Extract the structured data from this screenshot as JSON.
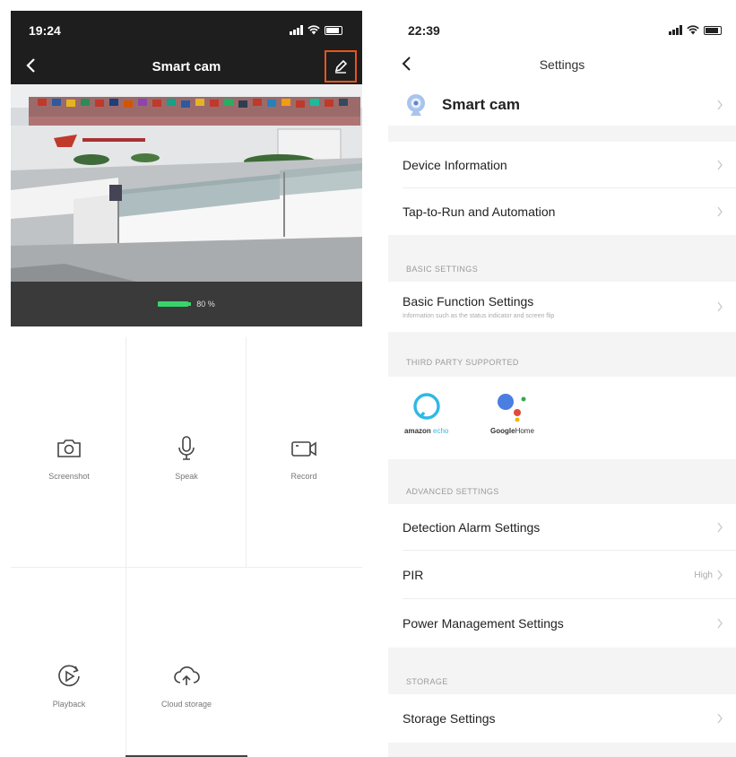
{
  "left_phone": {
    "status_time": "19:24",
    "nav_title": "Smart cam",
    "battery_text": "80 %",
    "battery_level": 0.8,
    "actions": [
      {
        "label": "Screenshot",
        "icon": "camera-icon"
      },
      {
        "label": "Speak",
        "icon": "microphone-icon"
      },
      {
        "label": "Record",
        "icon": "video-record-icon"
      },
      {
        "label": "Playback",
        "icon": "playback-icon"
      },
      {
        "label": "Cloud storage",
        "icon": "cloud-upload-icon"
      }
    ],
    "colors": {
      "header": "#1e1e1e",
      "highlight": "#e8541a",
      "battery": "#38d46b"
    }
  },
  "right_phone": {
    "status_time": "22:39",
    "nav_title": "Settings",
    "device_name": "Smart cam",
    "rows": {
      "device_information": "Device Information",
      "tap_to_run": "Tap-to-Run and Automation",
      "basic_function": "Basic Function Settings",
      "basic_function_sub": "Information such as the status indicator and screen flip",
      "detection_alarm": "Detection Alarm Settings",
      "pir": "PIR",
      "pir_value": "High",
      "power_management": "Power Management Settings",
      "storage_settings": "Storage Settings"
    },
    "sections": {
      "basic": "BASIC SETTINGS",
      "third_party": "THIRD PARTY SUPPORTED",
      "advanced": "ADVANCED SETTINGS",
      "storage": "STORAGE"
    },
    "third_party": [
      {
        "caption_a": "amazon",
        "caption_b": "echo",
        "icon": "amazon-alexa-icon"
      },
      {
        "caption_a": "Google",
        "caption_b": "Home",
        "icon": "google-assistant-icon"
      }
    ]
  }
}
